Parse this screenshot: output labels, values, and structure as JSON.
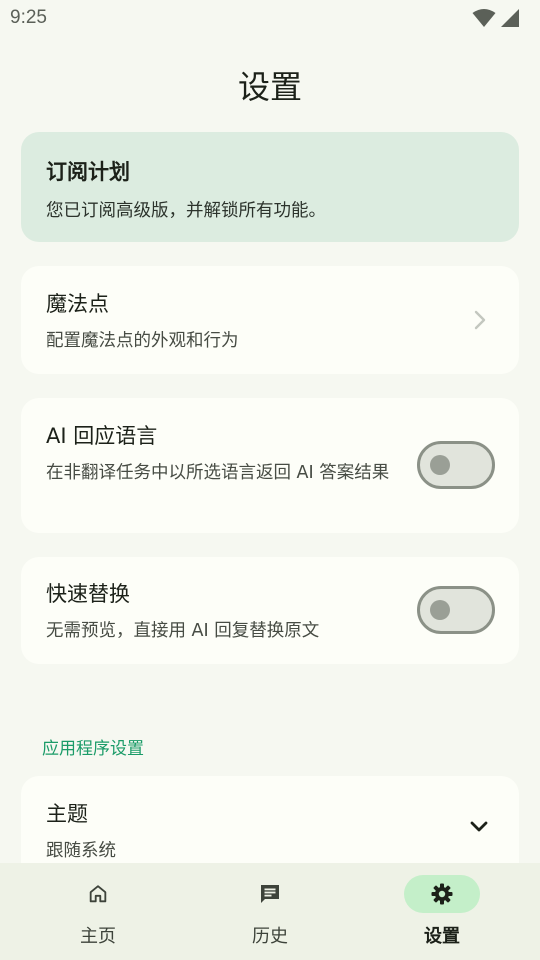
{
  "status_bar": {
    "time": "9:25"
  },
  "page": {
    "title": "设置"
  },
  "subscription": {
    "title": "订阅计划",
    "description": "您已订阅高级版，并解锁所有功能。"
  },
  "magic_dot": {
    "title": "魔法点",
    "description": "配置魔法点的外观和行为"
  },
  "ai_language": {
    "title": "AI 回应语言",
    "description": "在非翻译任务中以所选语言返回 AI 答案结果",
    "enabled": false
  },
  "quick_replace": {
    "title": "快速替换",
    "description": "无需预览，直接用 AI 回复替换原文",
    "enabled": false
  },
  "app_settings": {
    "section_label": "应用程序设置",
    "theme": {
      "title": "主题",
      "value": "跟随系统"
    }
  },
  "bottom_nav": {
    "items": [
      {
        "label": "主页",
        "icon": "home-icon",
        "active": false
      },
      {
        "label": "历史",
        "icon": "history-icon",
        "active": false
      },
      {
        "label": "设置",
        "icon": "gear-icon",
        "active": true
      }
    ]
  },
  "colors": {
    "background": "#f6f8f1",
    "subscription_card": "#dcece0",
    "section_accent": "#1a9b68",
    "active_nav_pill": "#c4efc9"
  }
}
